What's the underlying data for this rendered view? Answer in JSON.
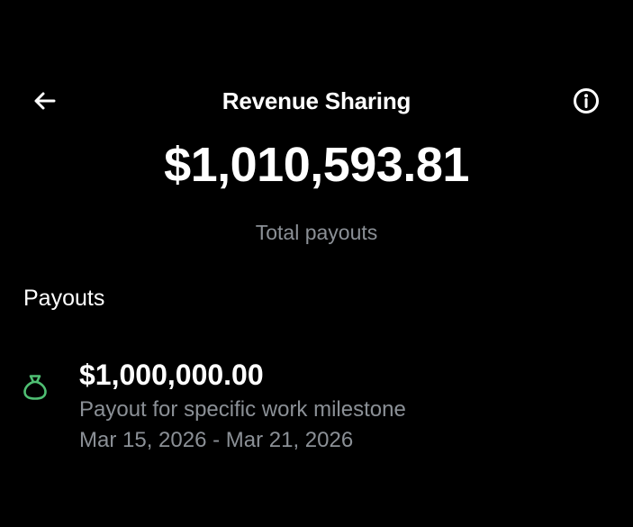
{
  "header": {
    "back_icon": "arrow-left-icon",
    "title": "Revenue Sharing",
    "info_icon": "info-circle-icon"
  },
  "summary": {
    "total_amount": "$1,010,593.81",
    "total_label": "Total payouts"
  },
  "payouts": {
    "section_title": "Payouts",
    "items": [
      {
        "icon": "money-bag-icon",
        "amount": "$1,000,000.00",
        "description": "Payout for specific work milestone",
        "date_range": "Mar 15, 2026 - Mar 21, 2026"
      }
    ]
  },
  "colors": {
    "background": "#000000",
    "text_primary": "#ffffff",
    "text_secondary": "#8b9096",
    "accent_green": "#4fbf73"
  }
}
